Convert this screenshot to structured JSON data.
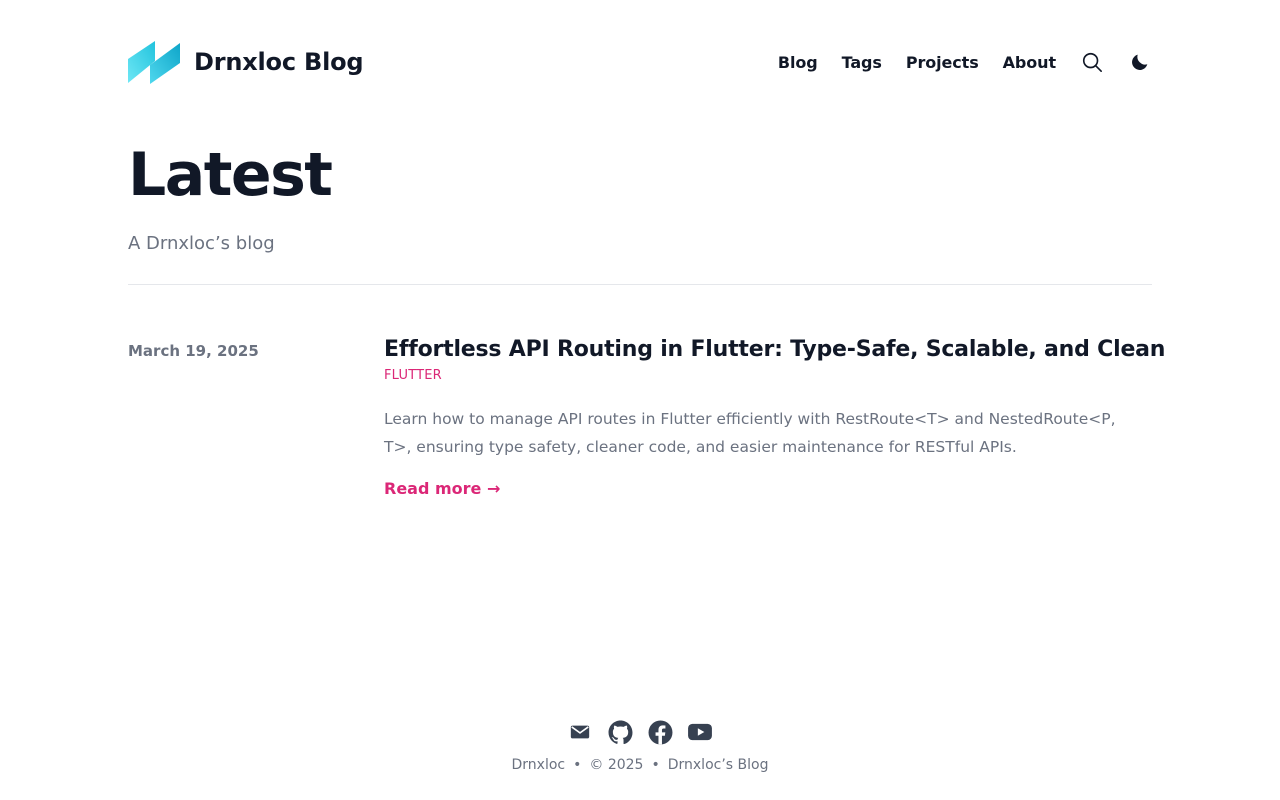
{
  "header": {
    "title": "Drnxloc Blog",
    "nav": [
      {
        "label": "Blog"
      },
      {
        "label": "Tags"
      },
      {
        "label": "Projects"
      },
      {
        "label": "About"
      }
    ],
    "icons": {
      "search": "search-icon",
      "theme": "moon-icon"
    }
  },
  "hero": {
    "title": "Latest",
    "subtitle": "A Drnxloc’s blog"
  },
  "posts": [
    {
      "date": "March 19, 2025",
      "title": "Effortless API Routing in Flutter: Type-Safe, Scalable, and Clean",
      "tag": "FLUTTER",
      "summary": "Learn how to manage API routes in Flutter efficiently with RestRoute<T> and NestedRoute<P, T>, ensuring type safety, cleaner code, and easier maintenance for RESTful APIs.",
      "read_more": "Read more →"
    }
  ],
  "footer": {
    "author": "Drnxloc",
    "sep": "•",
    "copyright": "© 2025",
    "site": "Drnxloc’s Blog",
    "social": [
      "mail-icon",
      "github-icon",
      "facebook-icon",
      "youtube-icon"
    ]
  },
  "colors": {
    "accent": "#db2777",
    "text": "#111827",
    "muted": "#6b7280",
    "logo_light": "#5ce1f0",
    "logo_dark": "#1fb6d6"
  }
}
